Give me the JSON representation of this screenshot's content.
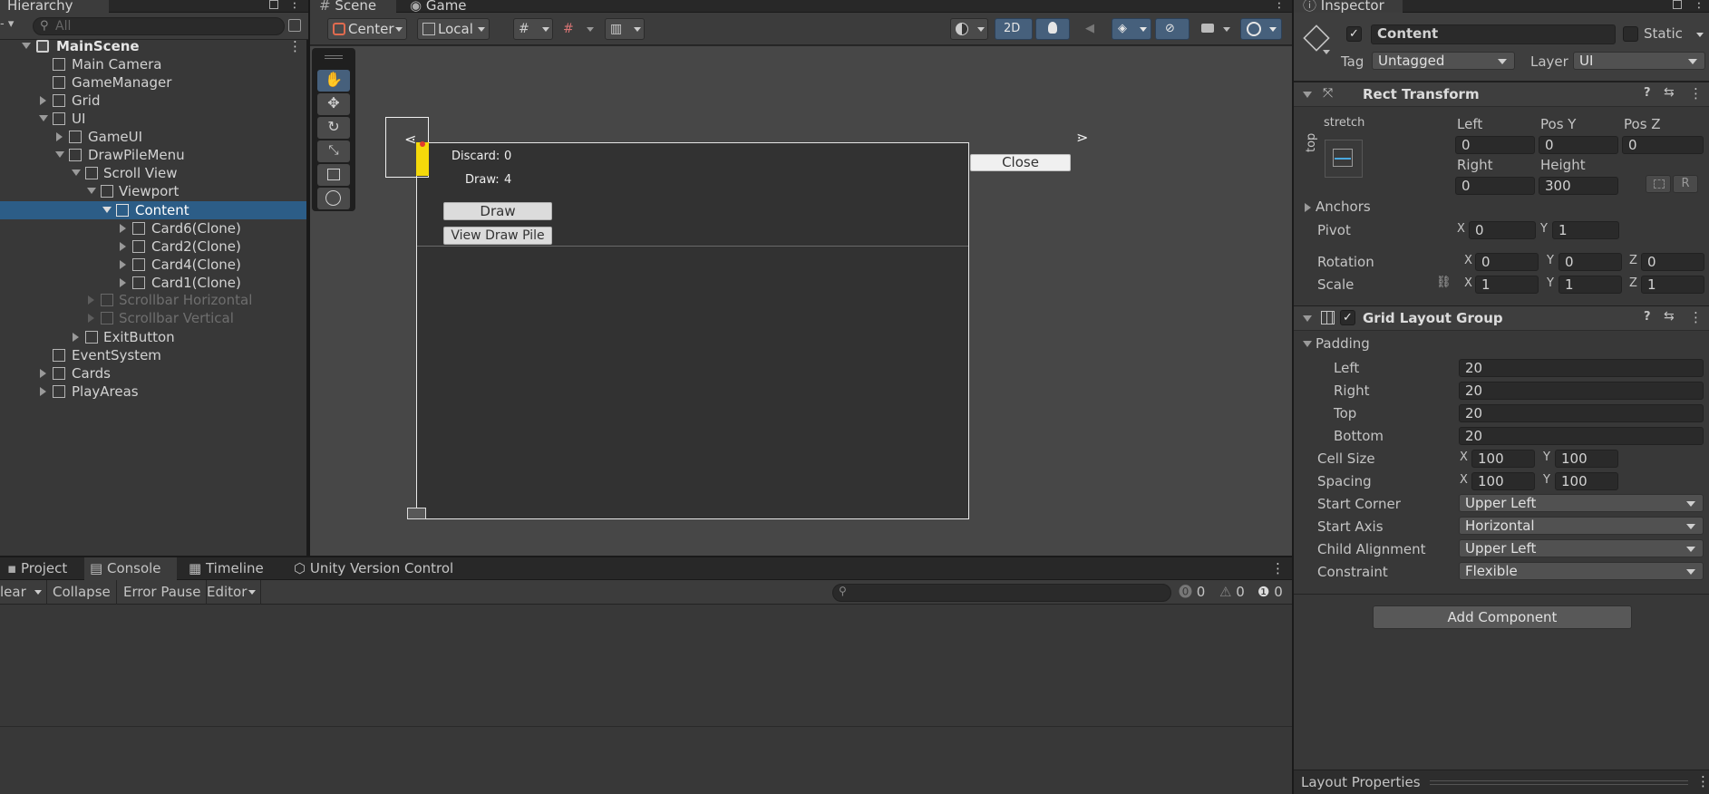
{
  "hierarchy": {
    "title": "Hierarchy",
    "search_placeholder": "All",
    "items": [
      {
        "label": "MainScene"
      },
      {
        "label": "Main Camera"
      },
      {
        "label": "GameManager"
      },
      {
        "label": "Grid"
      },
      {
        "label": "UI"
      },
      {
        "label": "GameUI"
      },
      {
        "label": "DrawPileMenu"
      },
      {
        "label": "Scroll View"
      },
      {
        "label": "Viewport"
      },
      {
        "label": "Content"
      },
      {
        "label": "Card6(Clone)"
      },
      {
        "label": "Card2(Clone)"
      },
      {
        "label": "Card4(Clone)"
      },
      {
        "label": "Card1(Clone)"
      },
      {
        "label": "Scrollbar Horizontal"
      },
      {
        "label": "Scrollbar Vertical"
      },
      {
        "label": "ExitButton"
      },
      {
        "label": "EventSystem"
      },
      {
        "label": "Cards"
      },
      {
        "label": "PlayAreas"
      }
    ]
  },
  "scene": {
    "tabs": {
      "scene": "Scene",
      "game": "Game"
    },
    "toolbar": {
      "pivot": "Center",
      "space": "Local",
      "mode2d": "2D"
    },
    "canvas": {
      "discard_label": "Discard:",
      "discard_value": "0",
      "draw_label": "Draw:",
      "draw_value": "4",
      "draw_button": "Draw",
      "view_button": "View Draw Pile",
      "close_button": "Close"
    }
  },
  "bottom": {
    "tabs": {
      "project": "Project",
      "console": "Console",
      "timeline": "Timeline",
      "uvc": "Unity Version Control"
    },
    "toolbar": {
      "clear": "lear",
      "collapse": "Collapse",
      "error_pause": "Error Pause",
      "editor": "Editor"
    },
    "counts": {
      "errors": "0",
      "warnings": "0",
      "infos": "0"
    }
  },
  "inspector": {
    "title": "Inspector",
    "object_name": "Content",
    "static_label": "Static",
    "tag_label": "Tag",
    "tag_value": "Untagged",
    "layer_label": "Layer",
    "layer_value": "UI",
    "rect": {
      "title": "Rect Transform",
      "anchor_h": "stretch",
      "anchor_v": "top",
      "left_label": "Left",
      "left": "0",
      "posy_label": "Pos Y",
      "posy": "0",
      "posz_label": "Pos Z",
      "posz": "0",
      "right_label": "Right",
      "right": "0",
      "height_label": "Height",
      "height": "300",
      "r_btn": "R",
      "anchors": "Anchors",
      "pivot": "Pivot",
      "pivot_x": "0",
      "pivot_y": "1",
      "rotation": "Rotation",
      "rot_x": "0",
      "rot_y": "0",
      "rot_z": "0",
      "scale": "Scale",
      "scale_x": "1",
      "scale_y": "1",
      "scale_z": "1",
      "x": "X",
      "y": "Y",
      "z": "Z"
    },
    "grid": {
      "title": "Grid Layout Group",
      "padding": "Padding",
      "left_label": "Left",
      "left": "20",
      "right_label": "Right",
      "right": "20",
      "top_label": "Top",
      "top": "20",
      "bottom_label": "Bottom",
      "bottom": "20",
      "cell_size": "Cell Size",
      "cell_x": "100",
      "cell_y": "100",
      "spacing": "Spacing",
      "spacing_x": "100",
      "spacing_y": "100",
      "start_corner": "Start Corner",
      "start_corner_value": "Upper Left",
      "start_axis": "Start Axis",
      "start_axis_value": "Horizontal",
      "child_alignment": "Child Alignment",
      "child_alignment_value": "Upper Left",
      "constraint": "Constraint",
      "constraint_value": "Flexible"
    },
    "add_component": "Add Component",
    "layout_properties": "Layout Properties"
  }
}
